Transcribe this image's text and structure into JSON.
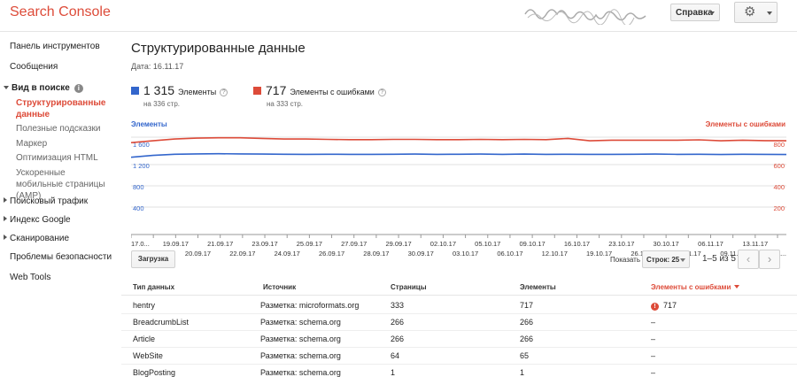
{
  "app": {
    "title": "Search Console"
  },
  "header": {
    "help_label": "Справка",
    "settings_icon": "gear-icon"
  },
  "sidebar": {
    "items": [
      {
        "label": "Панель инструментов"
      },
      {
        "label": "Сообщения"
      },
      {
        "label": "Вид в поиске",
        "expanded": true
      },
      {
        "label": "Структурированные данные",
        "active": true
      },
      {
        "label": "Полезные подсказки"
      },
      {
        "label": "Маркер"
      },
      {
        "label": "Оптимизация HTML"
      },
      {
        "label": "Ускоренные мобильные страницы (AMP)"
      },
      {
        "label": "Поисковый трафик"
      },
      {
        "label": "Индекс Google"
      },
      {
        "label": "Сканирование"
      },
      {
        "label": "Проблемы безопасности"
      },
      {
        "label": "Web Tools"
      }
    ]
  },
  "main": {
    "title": "Структурированные данные",
    "date": "Дата: 16.11.17",
    "stats": {
      "items_count": "1 315",
      "items_label": "Элементы",
      "items_sub": "на 336 стр.",
      "errors_count": "717",
      "errors_label": "Элементы с ошибками",
      "errors_sub": "на 333 стр.",
      "items_color": "#3366cc",
      "errors_color": "#dd4b39"
    },
    "toolbar": {
      "load_label": "Загрузка",
      "show_label": "Показать",
      "rows_label": "Строк: 25",
      "range_label": "1–5 из 5"
    },
    "table": {
      "headers": [
        "Тип данных",
        "Источник",
        "Страницы",
        "Элементы",
        "Элементы с ошибками"
      ],
      "rows": [
        [
          "hentry",
          "Разметка: microformats.org",
          "333",
          "717",
          "717"
        ],
        [
          "BreadcrumbList",
          "Разметка: schema.org",
          "266",
          "266",
          "–"
        ],
        [
          "Article",
          "Разметка: schema.org",
          "266",
          "266",
          "–"
        ],
        [
          "WebSite",
          "Разметка: schema.org",
          "64",
          "65",
          "–"
        ],
        [
          "BlogPosting",
          "Разметка: schema.org",
          "1",
          "1",
          "–"
        ]
      ]
    }
  },
  "chart_data": {
    "type": "line",
    "legend_left": "Элементы",
    "legend_right": "Элементы с ошибками",
    "y_left_ticks": [
      "1 600",
      "1 200",
      "800",
      "400"
    ],
    "y_right_ticks": [
      "800",
      "600",
      "400",
      "200"
    ],
    "ylim_left": [
      0,
      1600
    ],
    "ylim_right": [
      0,
      800
    ],
    "x_labels_top": [
      "17.0...",
      "19.09.17",
      "21.09.17",
      "23.09.17",
      "25.09.17",
      "27.09.17",
      "29.09.17",
      "02.10.17",
      "05.10.17",
      "09.10.17",
      "16.10.17",
      "23.10.17",
      "30.10.17",
      "06.11.17",
      "13.11.17"
    ],
    "x_labels_bottom": [
      "18.09.17",
      "20.09.17",
      "22.09.17",
      "24.09.17",
      "26.09.17",
      "28.09.17",
      "30.09.17",
      "03.10.17",
      "06.10.17",
      "12.10.17",
      "19.10.17",
      "26.10.17",
      "02.11.17",
      "09.11.17",
      "16.1..."
    ],
    "series": [
      {
        "name": "Элементы",
        "axis": "left",
        "color": "#3366cc",
        "values": [
          1270,
          1300,
          1320,
          1325,
          1328,
          1325,
          1322,
          1320,
          1318,
          1320,
          1318,
          1318,
          1320,
          1322,
          1318,
          1320,
          1322,
          1318,
          1322,
          1318,
          1320,
          1318,
          1318,
          1320,
          1322,
          1318,
          1320,
          1315,
          1320,
          1318,
          1315
        ]
      },
      {
        "name": "Элементы с ошибками",
        "axis": "right",
        "color": "#dd4b39",
        "values": [
          755,
          770,
          785,
          792,
          795,
          795,
          790,
          785,
          785,
          782,
          780,
          780,
          782,
          782,
          780,
          780,
          782,
          780,
          782,
          780,
          790,
          770,
          775,
          775,
          775,
          775,
          778,
          770,
          775,
          772,
          770
        ]
      }
    ]
  }
}
